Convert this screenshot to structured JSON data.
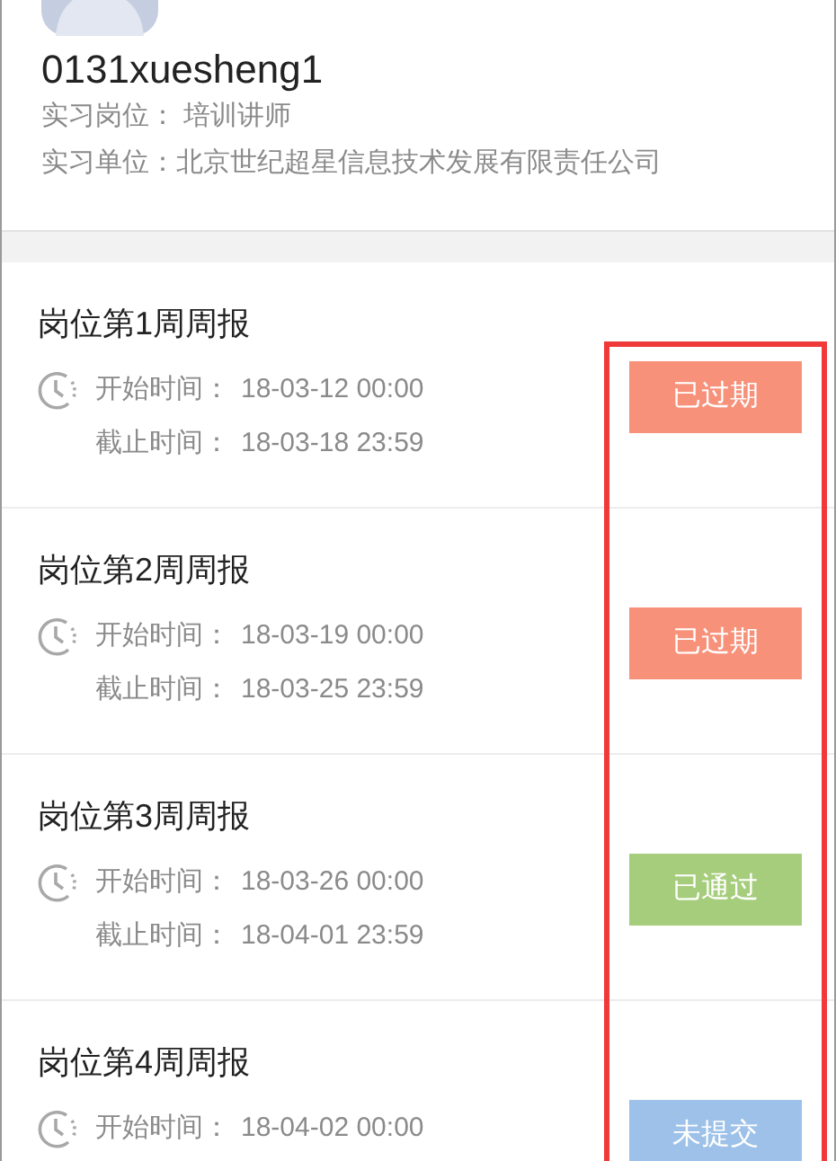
{
  "profile": {
    "username": "0131xuesheng1",
    "fields": [
      {
        "label": "实习岗位：",
        "value": " 培训讲师"
      },
      {
        "label": "实习单位：",
        "value": "北京世纪超星信息技术发展有限责任公司"
      }
    ]
  },
  "reports": [
    {
      "title": "岗位第1周周报",
      "times": [
        {
          "label": "开始时间：",
          "value": "18-03-12 00:00"
        },
        {
          "label": "截止时间：",
          "value": "18-03-18 23:59"
        }
      ],
      "status": {
        "kind": "expired",
        "label": "已过期"
      }
    },
    {
      "title": "岗位第2周周报",
      "times": [
        {
          "label": "开始时间：",
          "value": "18-03-19 00:00"
        },
        {
          "label": "截止时间：",
          "value": "18-03-25 23:59"
        }
      ],
      "status": {
        "kind": "expired",
        "label": "已过期"
      }
    },
    {
      "title": "岗位第3周周报",
      "times": [
        {
          "label": "开始时间：",
          "value": "18-03-26 00:00"
        },
        {
          "label": "截止时间：",
          "value": "18-04-01 23:59"
        }
      ],
      "status": {
        "kind": "passed",
        "label": "已通过"
      }
    },
    {
      "title": "岗位第4周周报",
      "times": [
        {
          "label": "开始时间：",
          "value": "18-04-02 00:00"
        }
      ],
      "status": {
        "kind": "unsubmitted",
        "label": "未提交"
      }
    }
  ],
  "highlight": {
    "shown": true
  }
}
